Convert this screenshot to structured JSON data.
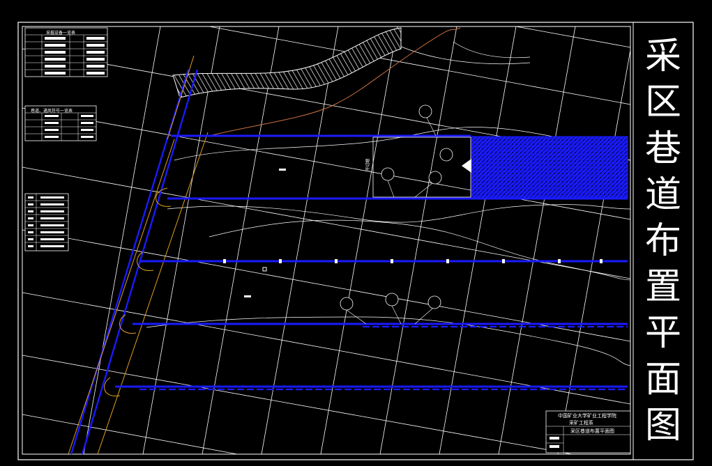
{
  "drawing": {
    "title": "采区巷道布置平面图",
    "title_chars": [
      "采",
      "区",
      "巷",
      "道",
      "布",
      "置",
      "平",
      "面",
      "图"
    ]
  },
  "title_block": {
    "line1": "中国矿业大学矿业工程学院",
    "line2": "采矿工程系",
    "line3": "采区巷道布置平面图"
  },
  "legends": {
    "legend_a_title": "采掘设备一览表",
    "legend_b_title": "巷道、通风符号一览表"
  },
  "annotations": {
    "cut_label": "开切眼"
  },
  "colors": {
    "background": "#000000",
    "frame": "#ffffff",
    "roadway": "#1a1aff",
    "boundary": "#e0a020",
    "contour": "#c87040",
    "grid": "#ffffff"
  }
}
